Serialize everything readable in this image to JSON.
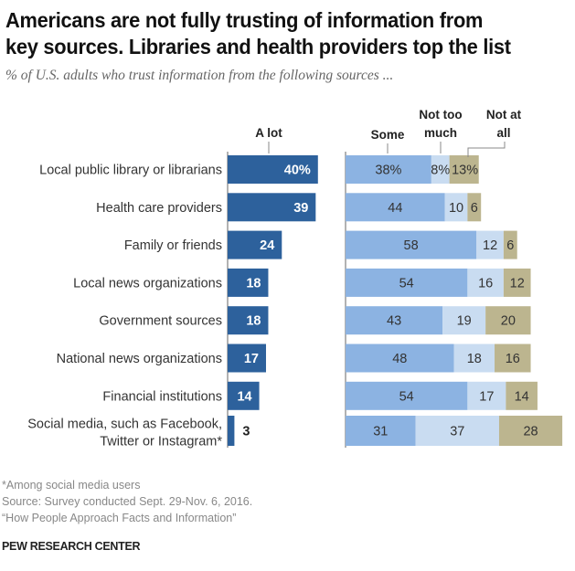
{
  "chart_data": {
    "type": "bar",
    "subtype": "diverging-stacked-horizontal",
    "title": "Americans are not fully trusting of information from key sources. Libraries and health providers top the list",
    "title_lines": [
      "Americans are not fully trusting of information from",
      "key sources. Libraries and health providers top the list"
    ],
    "subtitle": "% of U.S. adults who trust information from the following sources ...",
    "categories": [
      [
        "Local public library or librarians"
      ],
      [
        "Health care providers"
      ],
      [
        "Family or friends"
      ],
      [
        "Local news organizations"
      ],
      [
        "Government sources"
      ],
      [
        "National news organizations"
      ],
      [
        "Financial institutions"
      ],
      [
        "Social media, such as Facebook,",
        "Twitter or Instagram*"
      ]
    ],
    "series": [
      {
        "name": "A lot",
        "header_lines": [
          "A lot"
        ],
        "color": "#2d619c",
        "values": [
          40,
          39,
          24,
          18,
          18,
          17,
          14,
          3
        ],
        "labels": [
          "40%",
          "39",
          "24",
          "18",
          "18",
          "17",
          "14",
          "3"
        ]
      },
      {
        "name": "Some",
        "header_lines": [
          "Some"
        ],
        "color": "#8cb3e2",
        "values": [
          38,
          44,
          58,
          54,
          43,
          48,
          54,
          31
        ],
        "labels": [
          "38%",
          "44",
          "58",
          "54",
          "43",
          "48",
          "54",
          "31"
        ]
      },
      {
        "name": "Not too much",
        "header_lines": [
          "Not too",
          "much"
        ],
        "color": "#c9dcf1",
        "values": [
          8,
          10,
          12,
          16,
          19,
          18,
          17,
          37
        ],
        "labels": [
          "8%",
          "10",
          "12",
          "16",
          "19",
          "18",
          "17",
          "37"
        ]
      },
      {
        "name": "Not at all",
        "header_lines": [
          "Not at",
          "all"
        ],
        "color": "#bcb58f",
        "values": [
          13,
          6,
          6,
          12,
          20,
          16,
          14,
          28
        ],
        "labels": [
          "13%",
          "6",
          "6",
          "12",
          "20",
          "16",
          "14",
          "28"
        ]
      }
    ],
    "xlabel": "",
    "ylabel": "",
    "xlim": [
      0,
      100
    ],
    "grid": false,
    "legend": "column headers above bars"
  },
  "footer": {
    "note": "*Among social media users",
    "source": "Source:  Survey conducted Sept. 29-Nov. 6, 2016.",
    "report": "“How People Approach Facts and Information”"
  },
  "brand": "PEW RESEARCH CENTER"
}
